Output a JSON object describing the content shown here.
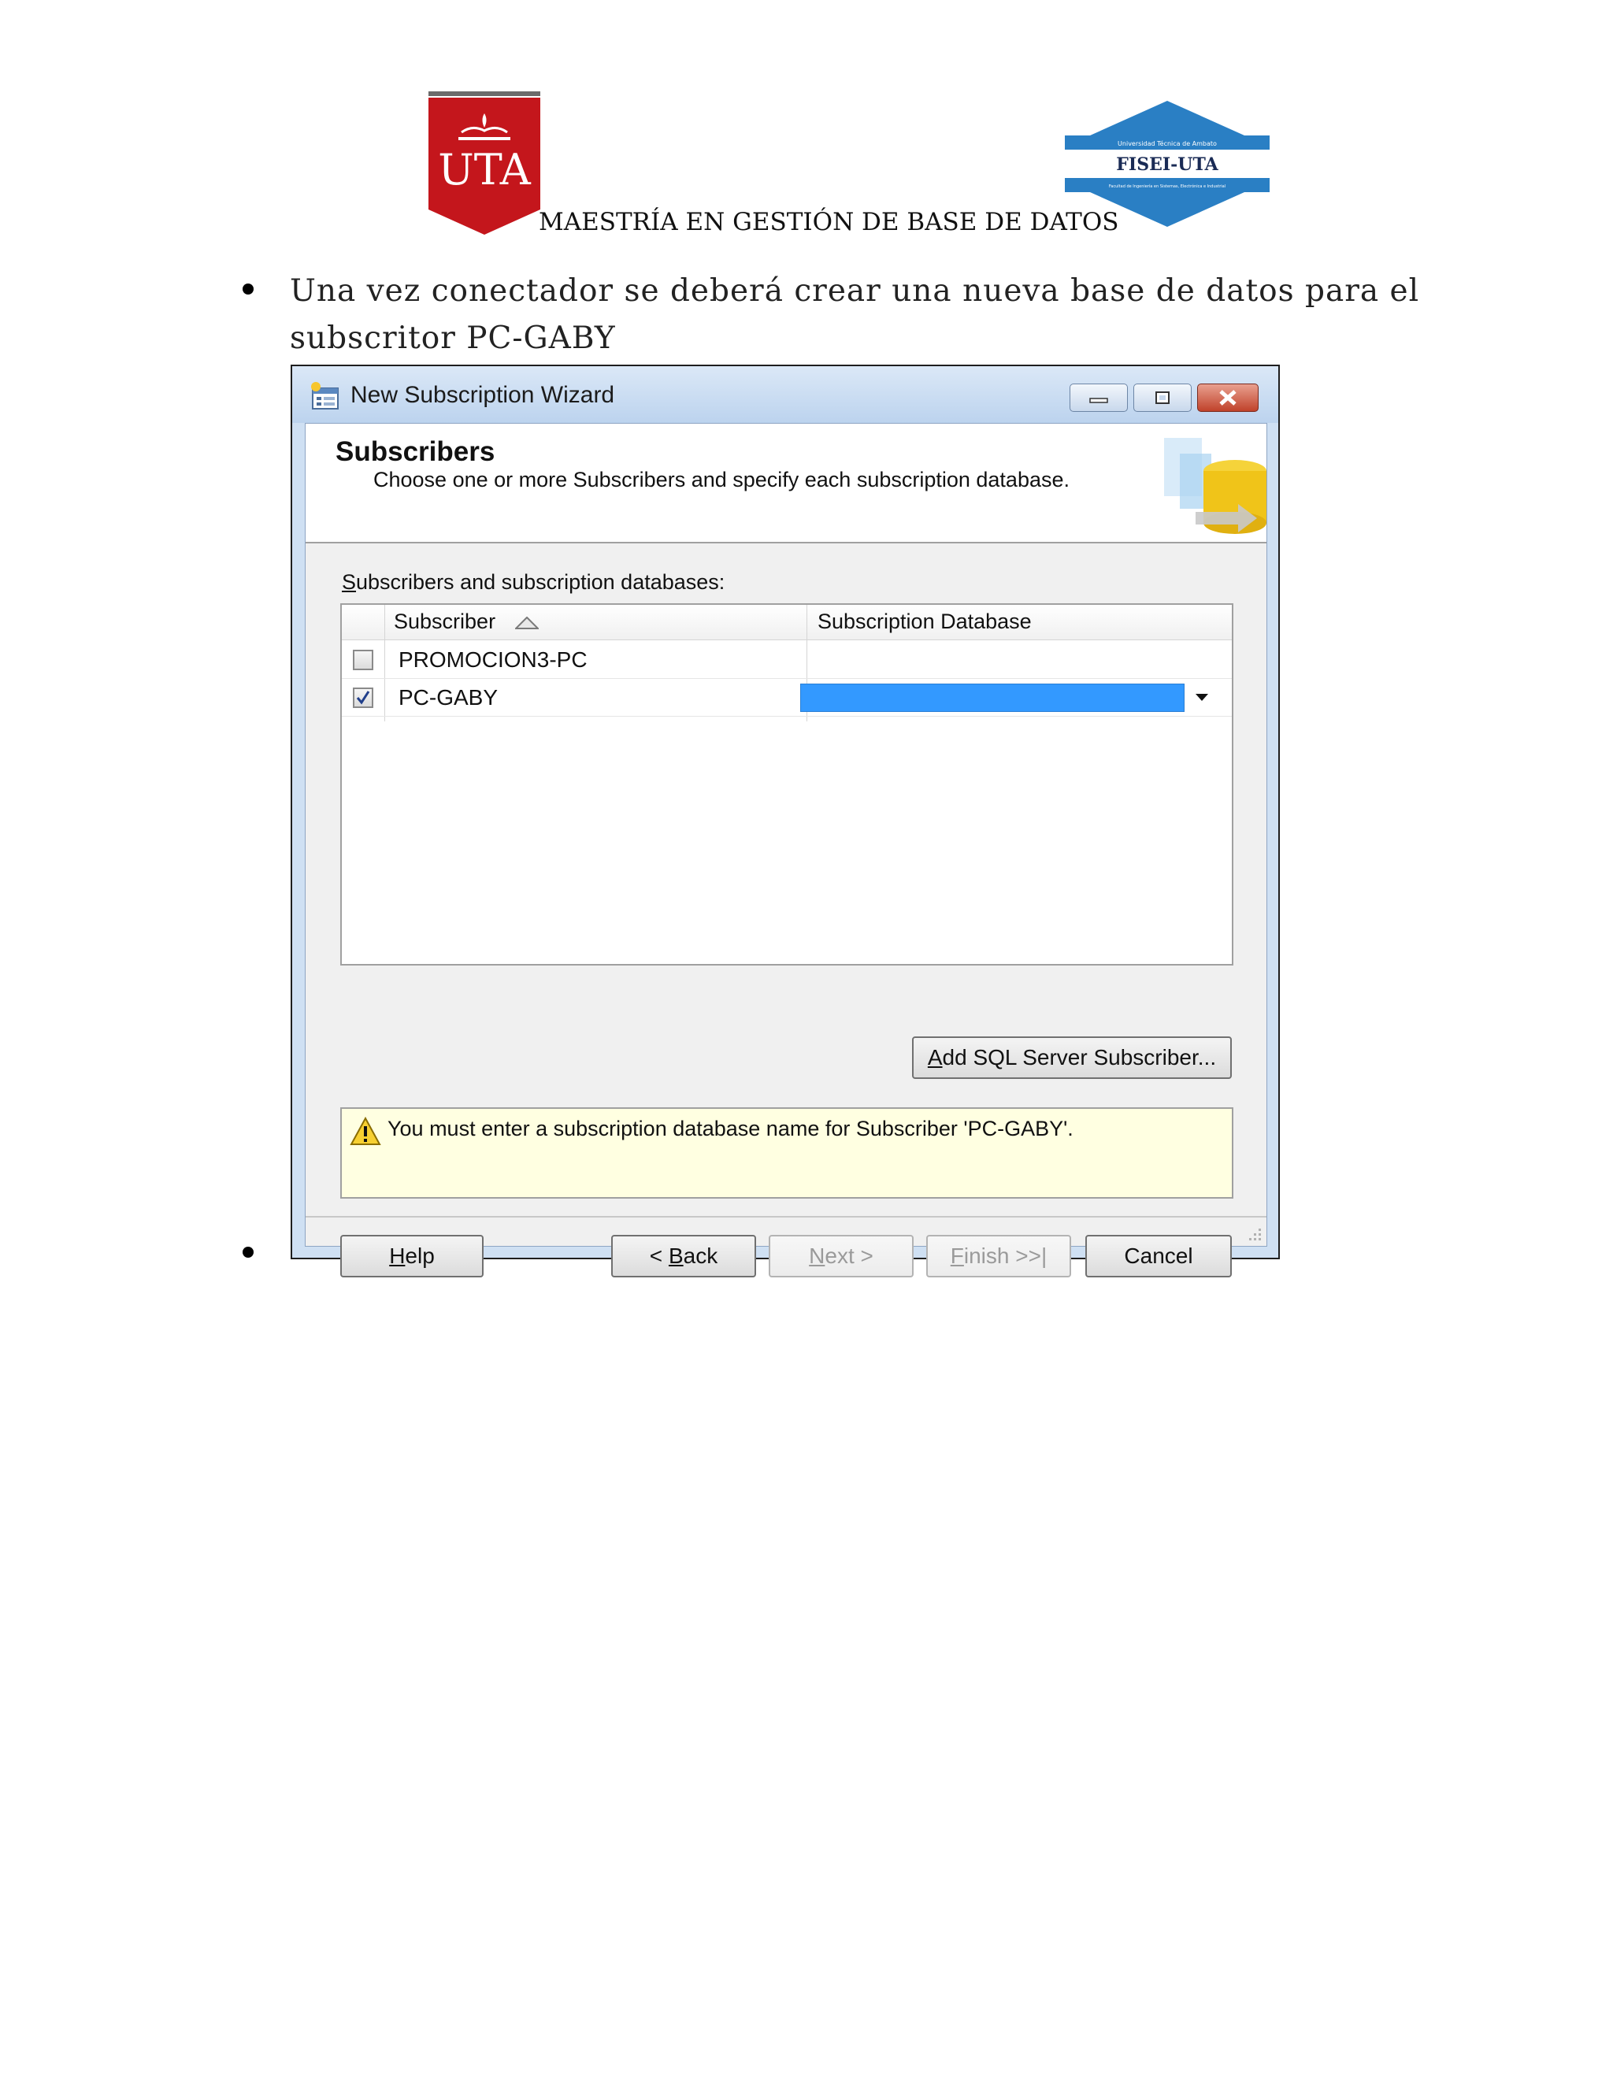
{
  "document": {
    "header_title": "MAESTRÍA EN GESTIÓN DE BASE DE DATOS",
    "uta_logo_text": "UTA",
    "fisei_logo_top": "Universidad Técnica de Ambato",
    "fisei_logo_main": "FISEI-UTA",
    "fisei_logo_bottom": "Facultad de Ingeniería en Sistemas, Electrónica e Industrial",
    "bullet_text": "Una vez conectador se deberá crear una nueva base de datos para el subscritor PC-GABY"
  },
  "window": {
    "title": "New Subscription Wizard",
    "page_title": "Subscribers",
    "page_subtitle": "Choose one or more Subscribers and specify each subscription database.",
    "list_label_underlined": "S",
    "list_label_rest": "ubscribers and subscription databases:",
    "columns": [
      "Subscriber",
      "Subscription Database"
    ],
    "rows": [
      {
        "subscriber": "PROMOCION3-PC",
        "checked": false,
        "database": ""
      },
      {
        "subscriber": "PC-GABY",
        "checked": true,
        "database": ""
      }
    ],
    "add_button": {
      "underlined": "A",
      "rest": "dd SQL Server Subscriber..."
    },
    "message": "You must enter a subscription database name for Subscriber 'PC-GABY'.",
    "buttons": {
      "help": {
        "underlined": "H",
        "rest": "elp"
      },
      "back": {
        "prefix": "< ",
        "underlined": "B",
        "rest": "ack"
      },
      "next": {
        "underlined": "N",
        "rest": "ext >"
      },
      "finish": {
        "underlined": "F",
        "rest": "inish >>|"
      },
      "cancel": "Cancel"
    }
  },
  "colors": {
    "selection_blue": "#3399ff",
    "uta_red": "#c4161c",
    "fisei_blue": "#2a7fc4",
    "warning_bg": "#ffffe1"
  }
}
